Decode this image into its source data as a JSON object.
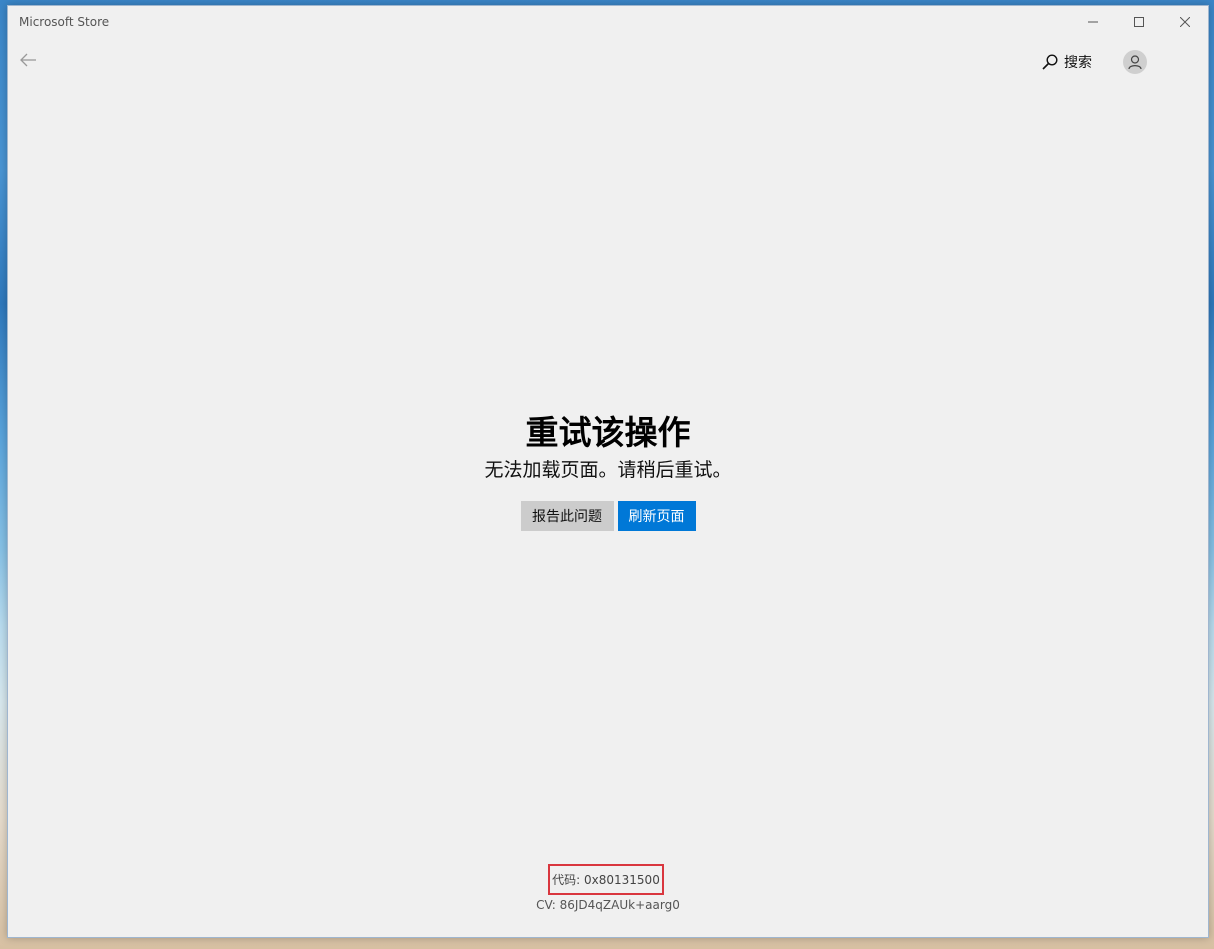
{
  "window": {
    "title": "Microsoft Store",
    "controls": {
      "minimize_icon": "minimize-icon",
      "maximize_icon": "maximize-icon",
      "close_icon": "close-icon"
    }
  },
  "navbar": {
    "back_icon": "back-arrow-icon",
    "search_label": "搜索",
    "search_icon": "search-icon",
    "avatar_icon": "user-icon"
  },
  "error": {
    "title": "重试该操作",
    "message": "无法加载页面。请稍后重试。",
    "report_button": "报告此问题",
    "refresh_button": "刷新页面",
    "code": "代码: 0x80131500",
    "cv": "CV: 86JD4qZAUk+aarg0"
  },
  "colors": {
    "accent": "#0078d7",
    "secondary_button": "#cccccc",
    "highlight_border": "#d9363e",
    "background": "#f0f0f0"
  }
}
